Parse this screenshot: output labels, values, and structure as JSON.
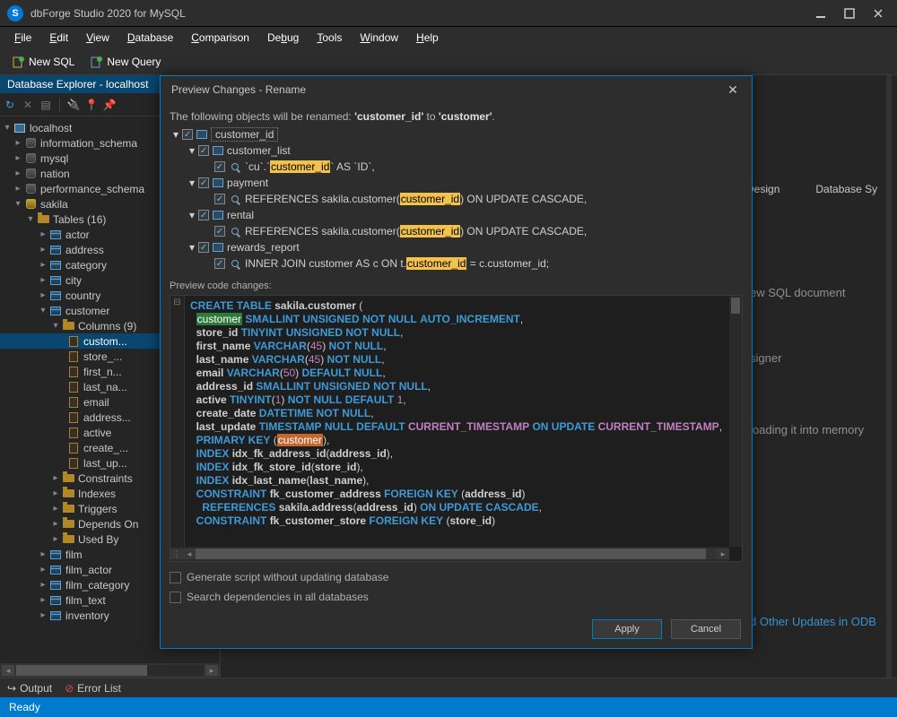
{
  "app": {
    "title": "dbForge Studio 2020 for MySQL"
  },
  "menu": [
    "File",
    "Edit",
    "View",
    "Database",
    "Comparison",
    "Debug",
    "Tools",
    "Window",
    "Help"
  ],
  "toolbar": {
    "newsql": "New SQL",
    "newquery": "New Query"
  },
  "explorer": {
    "title": "Database Explorer - localhost",
    "root": "localhost",
    "dbs": [
      "information_schema",
      "mysql",
      "nation",
      "performance_schema"
    ],
    "active_db": "sakila",
    "tables_label": "Tables (16)",
    "tables": [
      "actor",
      "address",
      "category",
      "city",
      "country",
      "customer"
    ],
    "columns_label": "Columns (9)",
    "columns": [
      "customer_id",
      "store_id",
      "first_name",
      "last_name",
      "email",
      "address_id",
      "active",
      "create_date",
      "last_update"
    ],
    "selected_col": "customer_id",
    "col_truncated": [
      "custom...",
      "store_...",
      "first_n...",
      "last_na...",
      "email",
      "address...",
      "active",
      "create_...",
      "last_up..."
    ],
    "subfolders": [
      "Constraints",
      "Indexes",
      "Triggers",
      "Depends On",
      "Used By"
    ],
    "tables_after": [
      "film",
      "film_actor",
      "film_category",
      "film_text",
      "inventory"
    ]
  },
  "start": {
    "tab_design": "se Design",
    "tab_sync": "Database Sy",
    "row1": "ew SQL document",
    "row2": "signer",
    "row3": "loading it into memory",
    "link1": "d Other Updates in ODB"
  },
  "footer": {
    "output": "Output",
    "errors": "Error List",
    "status": "Ready"
  },
  "modal": {
    "title": "Preview Changes - Rename",
    "intro_pre": "The following objects will be renamed: ",
    "intro_from": "'customer_id'",
    "intro_mid": " to ",
    "intro_to": "'customer'",
    "root": "customer_id",
    "n1": "customer_list",
    "n1_detail_pre": "`cu`.`",
    "n1_detail_hl": "customer_id",
    "n1_detail_post": "` AS `ID`,",
    "n2": "payment",
    "n2_detail_pre": "REFERENCES sakila.customer(",
    "n2_detail_hl": "customer_id",
    "n2_detail_post": ") ON UPDATE CASCADE,",
    "n3": "rental",
    "n3_detail_pre": "REFERENCES sakila.customer(",
    "n3_detail_hl": "customer_id",
    "n3_detail_post": ") ON UPDATE CASCADE,",
    "n4": "rewards_report",
    "n4_detail_pre": "INNER JOIN customer AS c ON t.",
    "n4_detail_hl": "customer_id",
    "n4_detail_post": " = c.customer_id;",
    "preview_label": "Preview code changes:",
    "opt1": "Generate script without updating database",
    "opt2": "Search dependencies in all databases",
    "apply": "Apply",
    "cancel": "Cancel"
  }
}
